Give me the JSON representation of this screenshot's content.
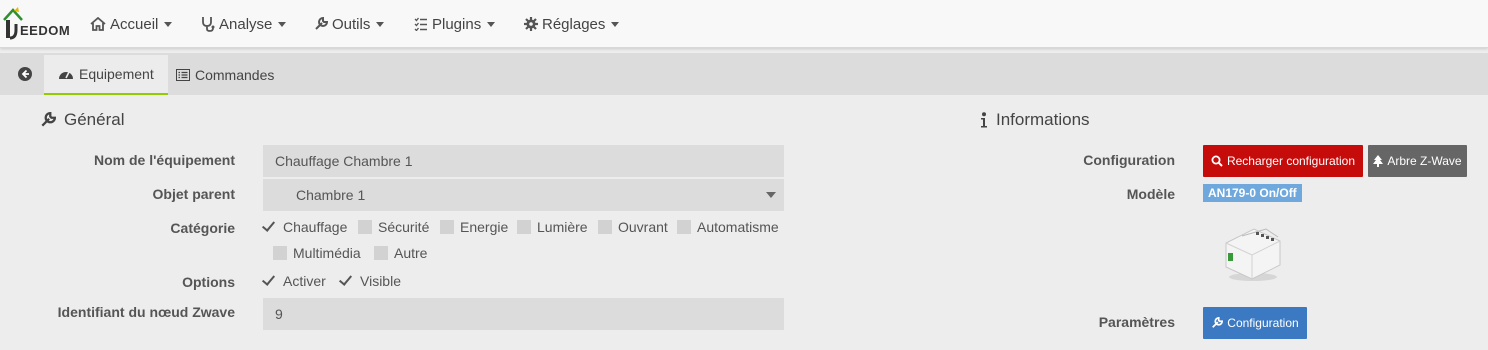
{
  "navbar": {
    "logo_text": "EEDOM",
    "items": [
      {
        "label": "Accueil",
        "icon": "home-icon"
      },
      {
        "label": "Analyse",
        "icon": "stethoscope-icon"
      },
      {
        "label": "Outils",
        "icon": "wrench-icon"
      },
      {
        "label": "Plugins",
        "icon": "tasks-icon"
      },
      {
        "label": "Réglages",
        "icon": "gear-icon"
      }
    ]
  },
  "tabs": {
    "equipement": "Equipement",
    "commandes": "Commandes"
  },
  "general": {
    "title": "Général",
    "nom_label": "Nom de l'équipement",
    "nom_value": "Chauffage Chambre 1",
    "objet_label": "Objet parent",
    "objet_value": "Chambre 1",
    "categorie_label": "Catégorie",
    "categories": [
      {
        "label": "Chauffage",
        "checked": true
      },
      {
        "label": "Sécurité",
        "checked": false
      },
      {
        "label": "Energie",
        "checked": false
      },
      {
        "label": "Lumière",
        "checked": false
      },
      {
        "label": "Ouvrant",
        "checked": false
      },
      {
        "label": "Automatisme",
        "checked": false
      },
      {
        "label": "Multimédia",
        "checked": false
      },
      {
        "label": "Autre",
        "checked": false
      }
    ],
    "options_label": "Options",
    "options": [
      {
        "label": "Activer",
        "checked": true
      },
      {
        "label": "Visible",
        "checked": true
      }
    ],
    "node_label": "Identifiant du nœud Zwave",
    "node_value": "9"
  },
  "informations": {
    "title": "Informations",
    "configuration_label": "Configuration",
    "reload_button": "Recharger configuration",
    "tree_button": "Arbre Z-Wave",
    "modele_label": "Modèle",
    "modele_value": "AN179-0 On/Off",
    "parametres_label": "Paramètres",
    "config_button": "Configuration"
  },
  "colors": {
    "accent": "#94ca02",
    "danger": "#c60b0b",
    "primary": "#3b79c2",
    "badge": "#6fa8dc"
  }
}
